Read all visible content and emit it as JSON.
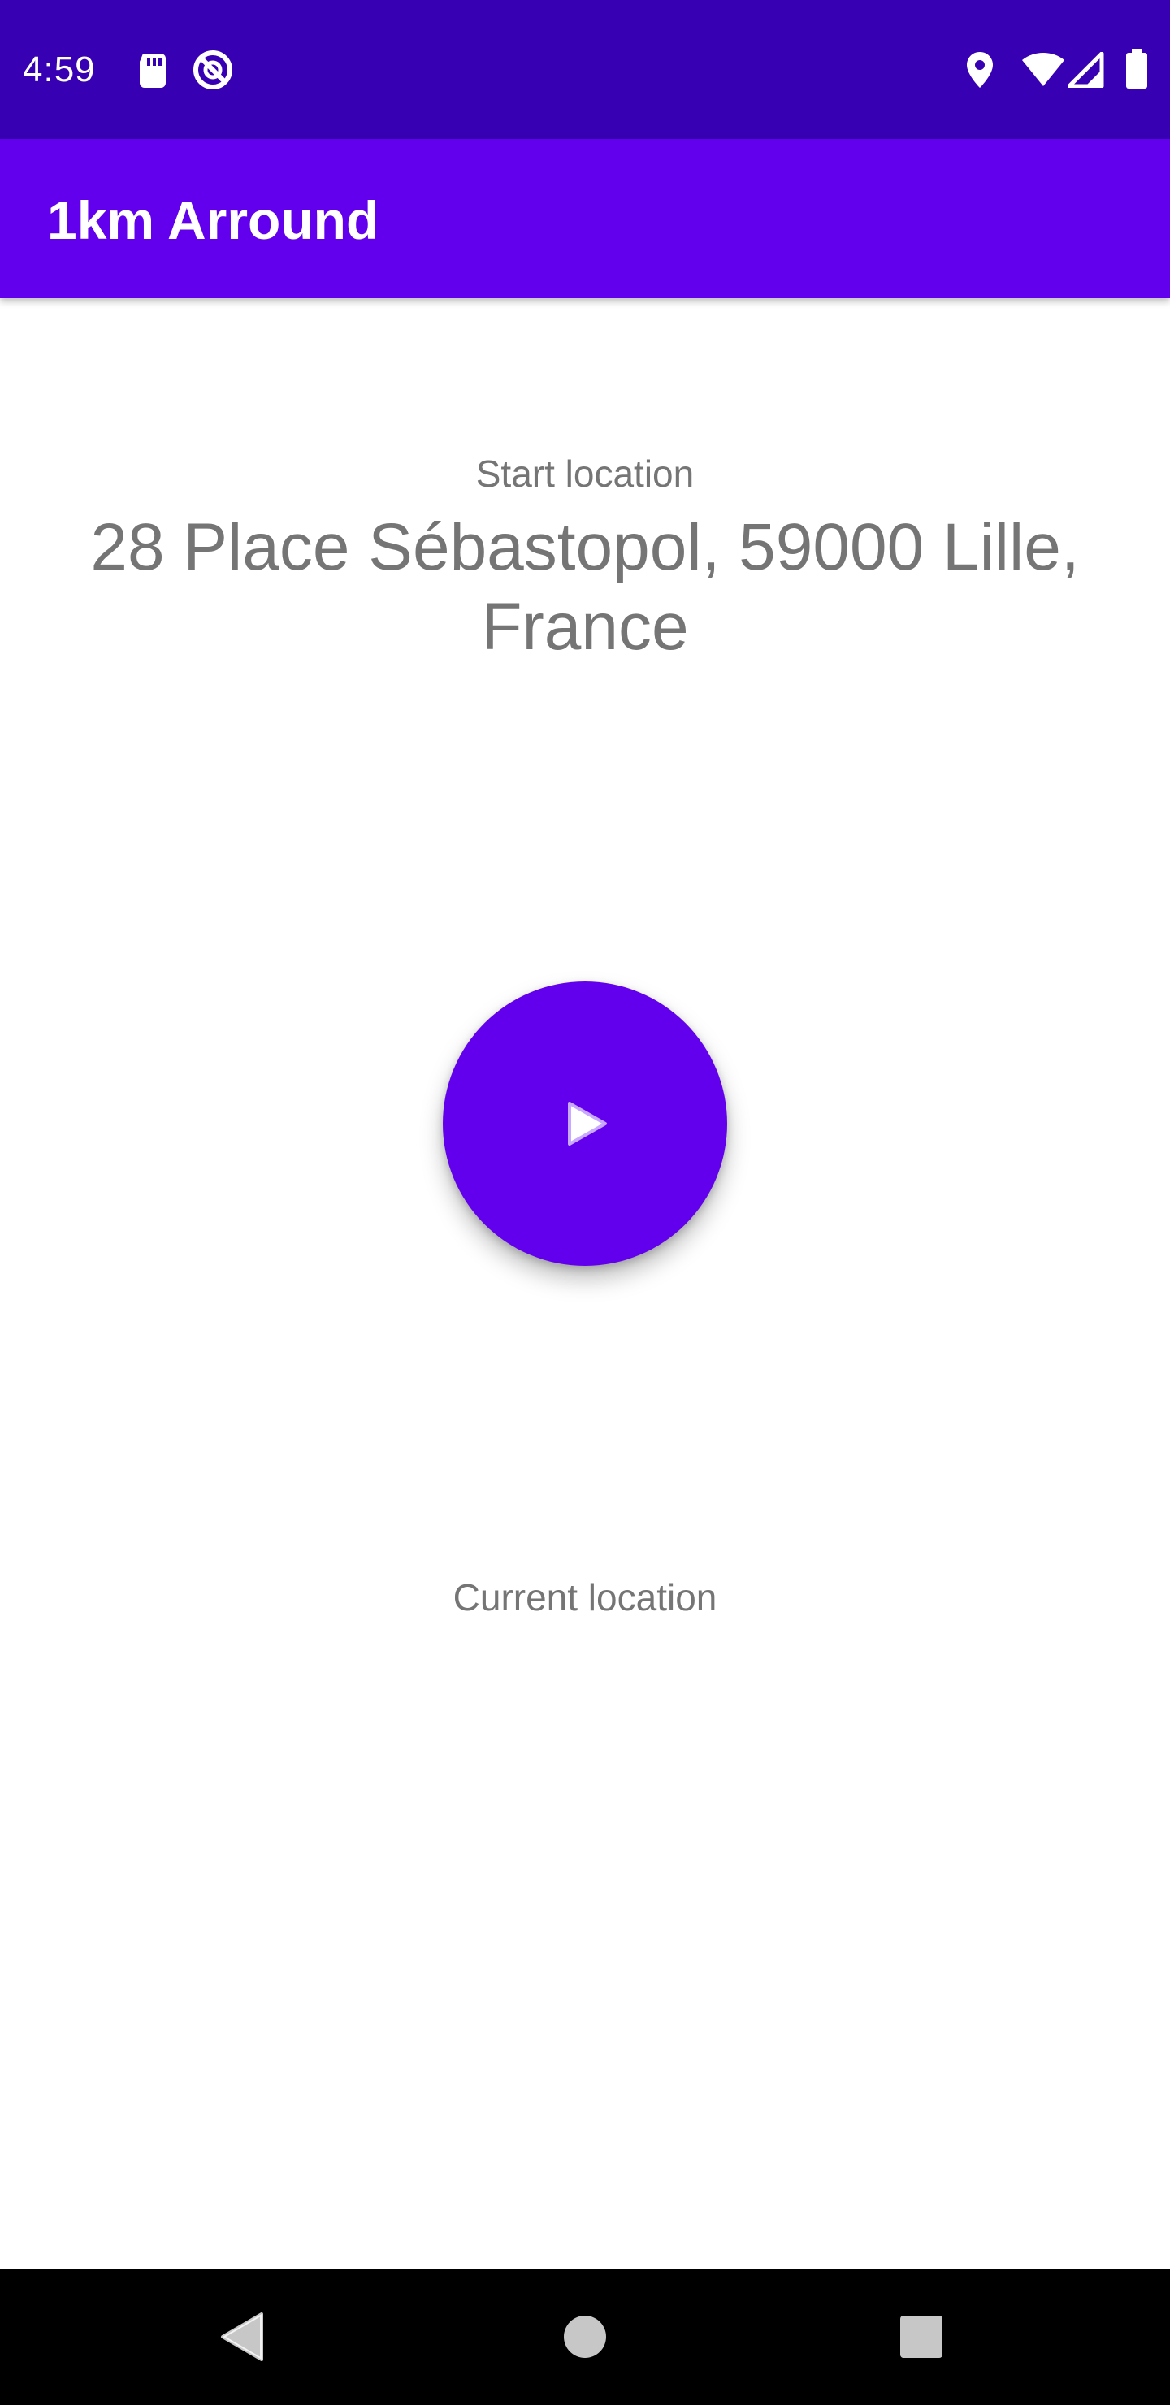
{
  "status_bar": {
    "time": "4:59",
    "icons": [
      "sd-card-icon",
      "data-saver-icon",
      "location-icon",
      "wifi-icon",
      "signal-icon",
      "battery-icon"
    ]
  },
  "app_bar": {
    "title": "1km Arround"
  },
  "main": {
    "start_label": "Start location",
    "start_address": "28 Place Sébastopol, 59000 Lille, France",
    "play_button_icon": "play-icon",
    "current_label": "Current location"
  },
  "nav_bar": {
    "buttons": [
      "back-icon",
      "home-icon",
      "recents-icon"
    ]
  },
  "colors": {
    "status_bar": "#3700b3",
    "app_bar": "#6200ee",
    "accent": "#6200ee",
    "secondary_text": "#757575"
  }
}
